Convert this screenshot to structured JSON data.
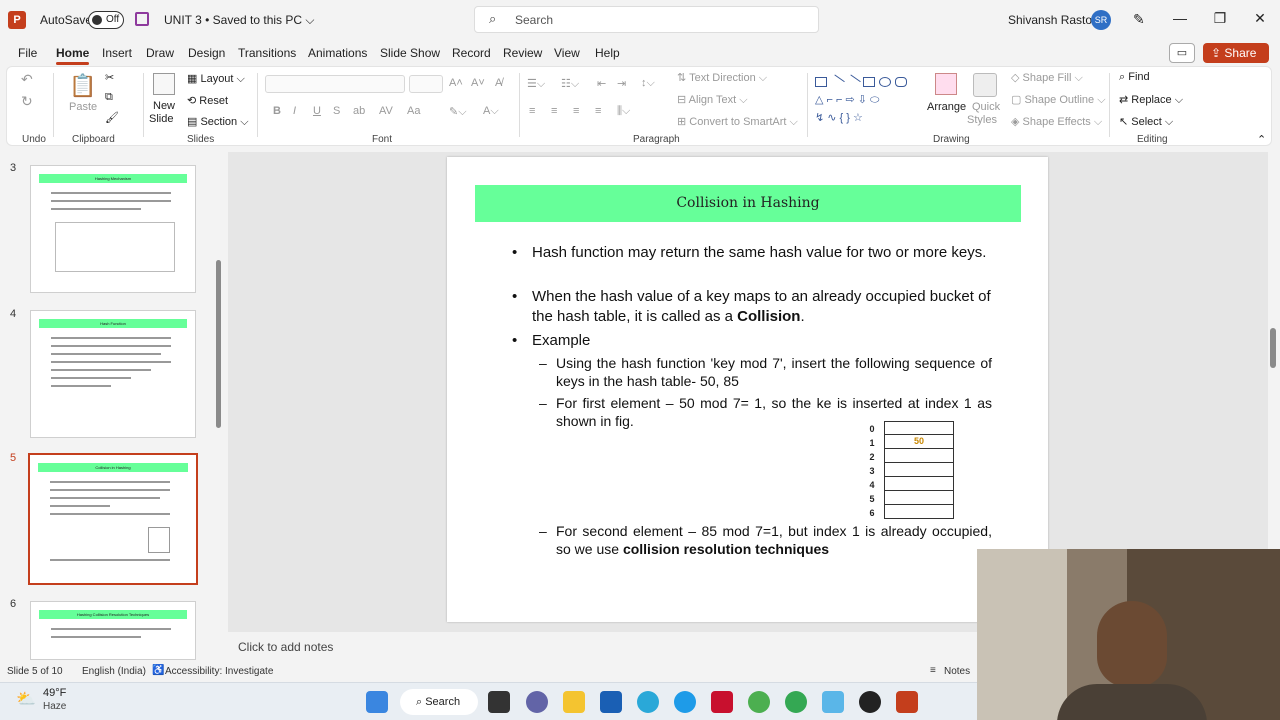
{
  "titlebar": {
    "autosave_label": "AutoSave",
    "autosave_state": "Off",
    "doc_title": "UNIT 3 • Saved to this PC ⌵",
    "search_placeholder": "Search",
    "user_name": "Shivansh Rastogi",
    "user_initials": "SR"
  },
  "menu": {
    "tabs": [
      "File",
      "Home",
      "Insert",
      "Draw",
      "Design",
      "Transitions",
      "Animations",
      "Slide Show",
      "Record",
      "Review",
      "View",
      "Help"
    ],
    "share_label": "Share"
  },
  "ribbon": {
    "undo_label": "Undo",
    "paste_label": "Paste",
    "clipboard_label": "Clipboard",
    "new_slide_label": "New",
    "new_slide_label2": "Slide",
    "layout_label": "Layout",
    "reset_label": "Reset",
    "section_label": "Section",
    "slides_label": "Slides",
    "font_label": "Font",
    "text_direction_label": "Text Direction",
    "align_text_label": "Align Text",
    "convert_label": "Convert to SmartArt",
    "paragraph_label": "Paragraph",
    "arrange_label": "Arrange",
    "quick_styles_label": "Quick",
    "quick_styles_label2": "Styles",
    "shape_fill_label": "Shape Fill",
    "shape_outline_label": "Shape Outline",
    "shape_effects_label": "Shape Effects",
    "drawing_label": "Drawing",
    "find_label": "Find",
    "replace_label": "Replace",
    "select_label": "Select",
    "editing_label": "Editing"
  },
  "thumbnails": [
    {
      "number": "3",
      "title": "Hashing Mechanism"
    },
    {
      "number": "4",
      "title": "Hash Function"
    },
    {
      "number": "5",
      "title": "Collision in Hashing"
    },
    {
      "number": "6",
      "title": "Hashing Collision Resolution Techniques"
    }
  ],
  "slide": {
    "title": "Collision in Hashing",
    "bullet1": "Hash function may return the same hash value for two or more keys.",
    "bullet2_pre": "When the hash value of a key maps to an already occupied bucket of the hash table, it is called as a ",
    "bullet2_bold": "Collision",
    "bullet2_post": ".",
    "bullet3": "Example",
    "sub1": "Using the hash function 'key mod 7', insert the following sequence of keys in the hash table- 50, 85",
    "sub2": "For first element – 50 mod 7= 1, so the ke is inserted at index 1 as shown in fig.",
    "sub3_pre": "For second element – 85 mod 7=1, but index 1 is already occupied, so we use ",
    "sub3_bold": "collision resolution techniques",
    "table_indices": [
      "0",
      "1",
      "2",
      "3",
      "4",
      "5",
      "6"
    ],
    "table_values": [
      "",
      "50",
      "",
      "",
      "",
      "",
      ""
    ]
  },
  "notes_placeholder": "Click to add notes",
  "status": {
    "slide_info": "Slide 5 of 10",
    "language": "English (India)",
    "accessibility": "Accessibility: Investigate",
    "notes_label": "Notes"
  },
  "taskbar": {
    "weather_temp": "49°F",
    "weather_desc": "Haze",
    "search_label": "Search"
  },
  "colors": {
    "accent": "#c43e1c",
    "title_bg": "#66ff99"
  }
}
